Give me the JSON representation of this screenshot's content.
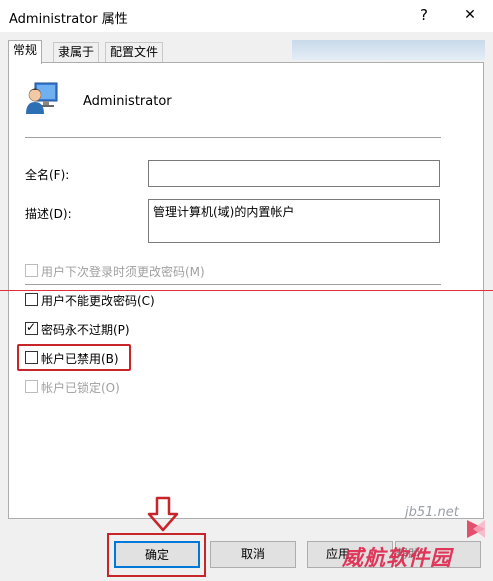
{
  "window": {
    "title": "Administrator 属性",
    "help_glyph": "?",
    "close_glyph": "✕"
  },
  "tabs": [
    {
      "label": "常规",
      "active": true
    },
    {
      "label": "隶属于",
      "active": false
    },
    {
      "label": "配置文件",
      "active": false
    }
  ],
  "user": {
    "name": "Administrator",
    "icon": "user-icon"
  },
  "fields": {
    "full_name": {
      "label": "全名(F):",
      "value": ""
    },
    "description": {
      "label": "描述(D):",
      "value": "管理计算机(域)的内置帐户"
    }
  },
  "checkboxes": [
    {
      "label": "用户下次登录时须更改密码(M)",
      "checked": false,
      "enabled": false
    },
    {
      "label": "用户不能更改密码(C)",
      "checked": false,
      "enabled": true
    },
    {
      "label": "密码永不过期(P)",
      "checked": true,
      "enabled": true
    },
    {
      "label": "帐户已禁用(B)",
      "checked": false,
      "enabled": true
    },
    {
      "label": "帐户已锁定(O)",
      "checked": false,
      "enabled": false
    }
  ],
  "buttons": {
    "ok": "确定",
    "cancel": "取消",
    "apply": "应用",
    "help": "帮助"
  },
  "watermark": {
    "site": "jb51.net",
    "brand": "威航软件园"
  },
  "colors": {
    "accent": "#0078d7",
    "annotation_red": "#c8252b"
  }
}
